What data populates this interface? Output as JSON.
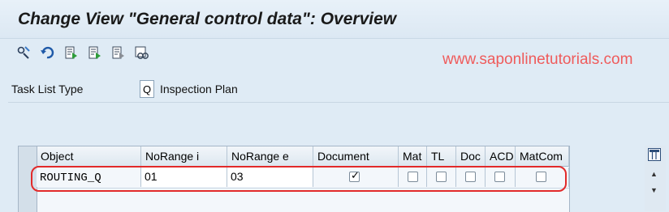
{
  "window": {
    "title": "Change View \"General control data\": Overview"
  },
  "toolbar": {
    "buttons": [
      {
        "name": "display-change-icon"
      },
      {
        "name": "undo-icon"
      },
      {
        "name": "new-entries-icon"
      },
      {
        "name": "copy-as-icon"
      },
      {
        "name": "delete-icon"
      },
      {
        "name": "select-all-icon"
      }
    ]
  },
  "watermark": "www.saponlinetutorials.com",
  "filter": {
    "label": "Task List Type",
    "value": "Q",
    "description": "Inspection Plan"
  },
  "table": {
    "columns": [
      "Object",
      "NoRange i",
      "NoRange e",
      "Document",
      "Mat",
      "TL",
      "Doc",
      "ACD",
      "MatCom"
    ],
    "rows": [
      {
        "object": "ROUTING_Q",
        "norange_i": "01",
        "norange_e": "03",
        "document": true,
        "mat": false,
        "tl": false,
        "doc": false,
        "acd": false,
        "matcom": false
      }
    ]
  },
  "colors": {
    "background": "#dfebf5",
    "highlight": "#e22a2a",
    "watermark": "#ef5b5b"
  }
}
